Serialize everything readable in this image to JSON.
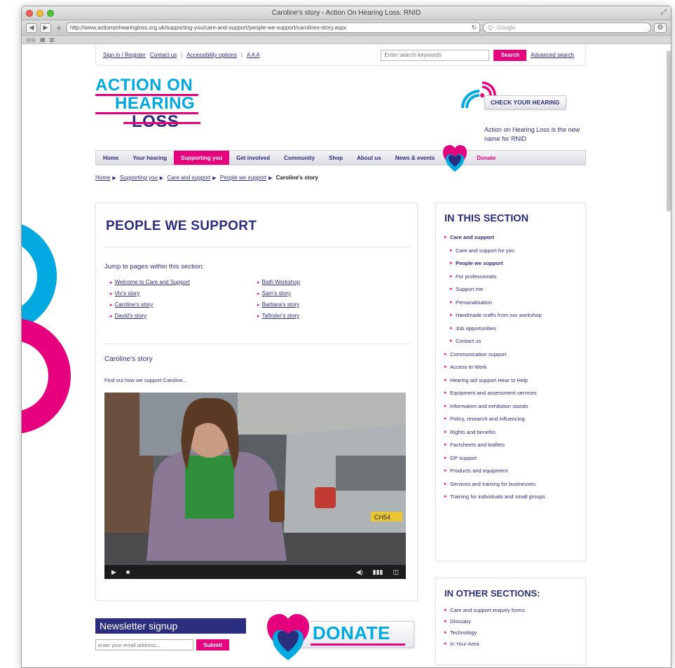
{
  "window": {
    "title": "Caroline's story - Action On Hearing Loss: RNID",
    "url": "http://www.actiononhearingloss.org.uk/supporting-you/care-and-support/people-we-support/carolines-story.aspx",
    "search_placeholder": "Q~ Google"
  },
  "topbar": {
    "signin": "Sign in / Register",
    "contact": "Contact us",
    "accessibility": "Accessibility options",
    "textsize": "A A A",
    "search_placeholder": "Enter search keywords",
    "search_button": "Search",
    "advanced": "Advanced search"
  },
  "logo": {
    "line1": "ACTION ON",
    "line2": "HEARING",
    "line3": "LOSS"
  },
  "check_hearing": "CHECK YOUR HEARING",
  "new_name": "Action on Hearing Loss is the new name for RNID",
  "nav": [
    "Home",
    "Your hearing",
    "Supporting you",
    "Get involved",
    "Community",
    "Shop",
    "About us",
    "News & events"
  ],
  "nav_donate": "Donate",
  "breadcrumb": {
    "home": "Home",
    "supporting": "Supporting you",
    "care": "Care and support",
    "people": "People we support",
    "current": "Caroline's story"
  },
  "main": {
    "title": "PEOPLE WE SUPPORT",
    "jump": "Jump to pages within this section:",
    "links": [
      "Welcome to Care and Support",
      "Bath Workshop",
      "Viv's story",
      "Sam's story",
      "Caroline's story",
      "Barbara's story",
      "David's story",
      "Tafinder's story"
    ],
    "story_title": "Caroline's story",
    "intro": "Find out how we support Caroline..."
  },
  "video": {
    "plate": "CH54"
  },
  "sidebar": {
    "title": "IN THIS SECTION",
    "items": [
      {
        "label": "Care and support",
        "level": 0,
        "bold": true
      },
      {
        "label": "Care and support for you",
        "level": 1
      },
      {
        "label": "People we support",
        "level": 1,
        "bold": true
      },
      {
        "label": "For professionals",
        "level": 1
      },
      {
        "label": "Support me",
        "level": 1
      },
      {
        "label": "Personalisation",
        "level": 1
      },
      {
        "label": "Handmade crafts from our workshop",
        "level": 1
      },
      {
        "label": "Job opportunities",
        "level": 1
      },
      {
        "label": "Contact us",
        "level": 1
      },
      {
        "label": "Communication support",
        "level": 0
      },
      {
        "label": "Access to Work",
        "level": 0
      },
      {
        "label": "Hearing aid support Hear to Help",
        "level": 0
      },
      {
        "label": "Equipment and assessment services",
        "level": 0
      },
      {
        "label": "Information and exhibition stands",
        "level": 0
      },
      {
        "label": "Policy, research and influencing",
        "level": 0
      },
      {
        "label": "Rights and benefits",
        "level": 0
      },
      {
        "label": "Factsheets and leaflets",
        "level": 0
      },
      {
        "label": "GP support",
        "level": 0
      },
      {
        "label": "Products and equipment",
        "level": 0
      },
      {
        "label": "Services and training for businesses",
        "level": 0
      },
      {
        "label": "Training for individuals and small groups",
        "level": 0
      }
    ]
  },
  "other": {
    "title": "IN OTHER SECTIONS:",
    "items": [
      "Care and support enquiry forms",
      "Glossary",
      "Technology",
      "In Your Area"
    ]
  },
  "newsletter": {
    "title": "Newsletter signup",
    "placeholder": "enter your email address...",
    "button": "Submit"
  },
  "donate_banner": "DONATE",
  "colors": {
    "navy": "#2b2e7e",
    "cyan": "#00a9e0",
    "pink": "#e6007e"
  }
}
